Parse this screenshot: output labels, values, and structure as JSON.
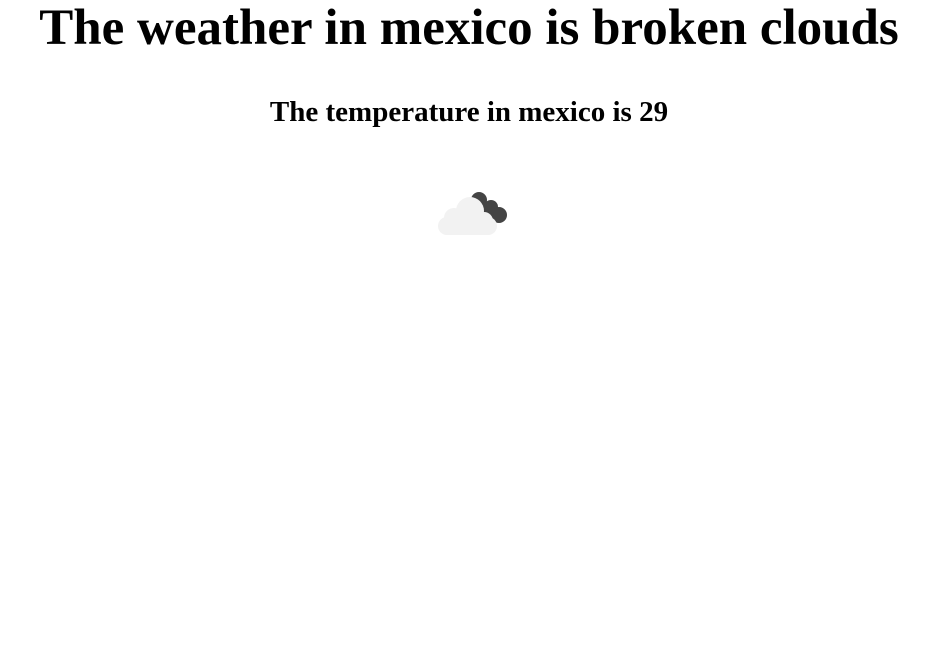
{
  "weather": {
    "headline": "The weather in mexico is broken clouds",
    "temperature_text": "The temperature in mexico is 29",
    "icon": "broken-clouds-icon",
    "colors": {
      "dark_cloud": "#444444",
      "light_cloud": "#f2f2f2"
    }
  }
}
